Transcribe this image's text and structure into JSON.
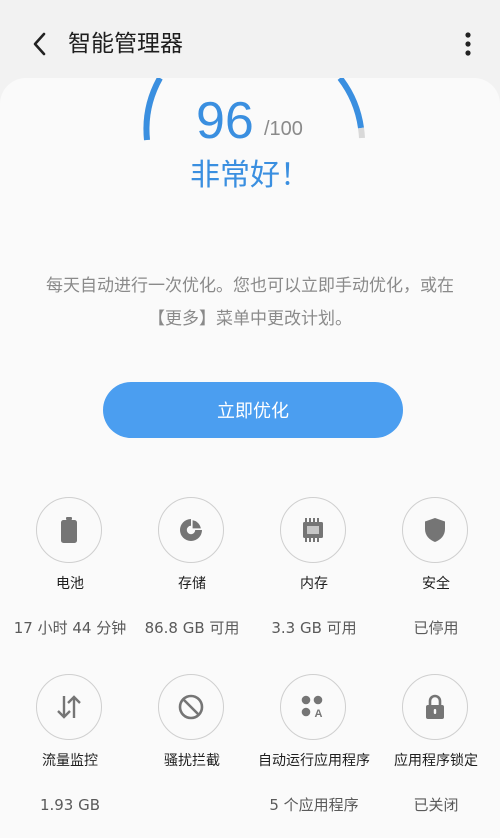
{
  "header": {
    "title": "智能管理器"
  },
  "score": {
    "value": "96",
    "max": "/100",
    "status": "非常好！",
    "fraction": 0.96
  },
  "description": "每天自动进行一次优化。您也可以立即手动优化，或在【更多】菜单中更改计划。",
  "optimize_button": "立即优化",
  "accent_color": "#3a8fe0",
  "tiles": [
    {
      "label": "电池",
      "value": "17 小时 44 分钟",
      "icon": "battery-icon"
    },
    {
      "label": "存储",
      "value": "86.8 GB 可用",
      "icon": "storage-pie-icon"
    },
    {
      "label": "内存",
      "value": "3.3 GB 可用",
      "icon": "memory-chip-icon"
    },
    {
      "label": "安全",
      "value": "已停用",
      "icon": "shield-icon"
    },
    {
      "label": "流量监控",
      "value": "1.93 GB",
      "icon": "data-transfer-icon"
    },
    {
      "label": "骚扰拦截",
      "value": "",
      "icon": "block-icon"
    },
    {
      "label": "自动运行应用程序",
      "value": "5 个应用程序",
      "icon": "auto-run-apps-icon"
    },
    {
      "label": "应用程序锁定",
      "value": "已关闭",
      "icon": "lock-icon"
    }
  ]
}
